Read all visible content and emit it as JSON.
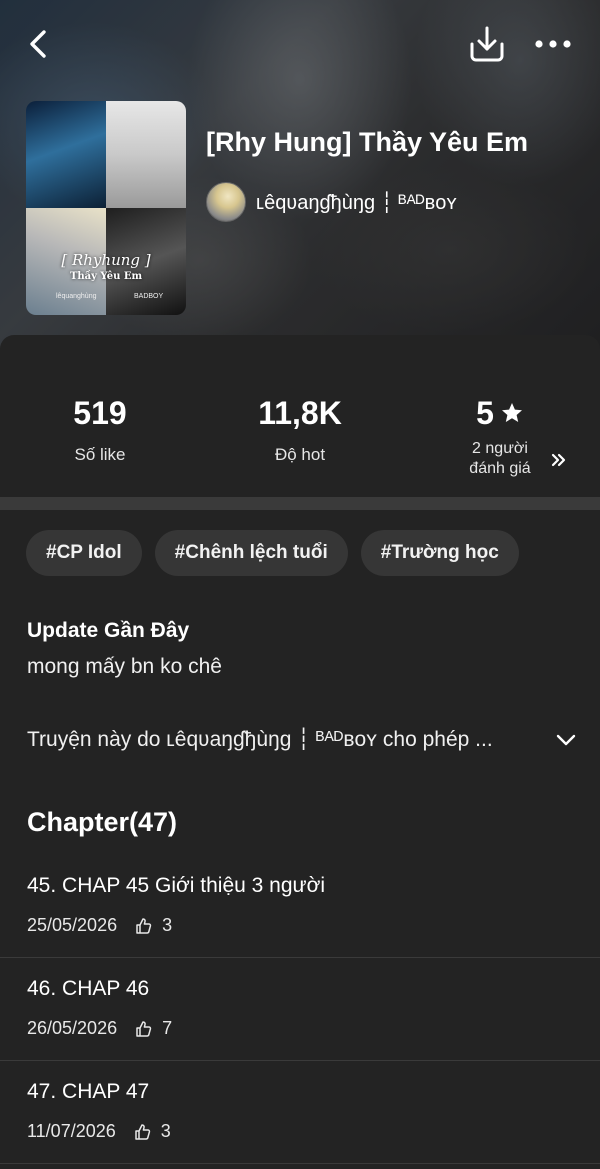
{
  "header": {
    "book_title": "[Rhy Hung] Thầy Yêu Em",
    "author_name": "ʟêqʋaŋɠђùŋg ┆ ᴮᴬᴰʙᴏʏ",
    "cover": {
      "script_text": "[ Rhyhung ]",
      "sub_text": "Thầy Yêu Em",
      "tiny_left": "lêquanghùng",
      "tiny_right": "BADBOY"
    }
  },
  "stats": {
    "likes": {
      "value": "519",
      "label": "Số like"
    },
    "hot": {
      "value": "11,8K",
      "label": "Độ hot"
    },
    "rating": {
      "value": "5",
      "label_line1": "2 người",
      "label_line2": "đánh giá"
    }
  },
  "tags": [
    "#CP Idol",
    "#Chênh lệch tuổi",
    "#Trường học"
  ],
  "update": {
    "title": "Update Gần Đây",
    "text": "mong mấy bn ko chê"
  },
  "description": "Truyện này do ʟêqʋaŋɠђùŋg ┆ ᴮᴬᴰʙᴏʏ cho phép ...",
  "chapters": {
    "heading": "Chapter(47)",
    "items": [
      {
        "title": "45. CHAP 45 Giới thiệu 3 người",
        "date": "25/05/2026",
        "likes": "3"
      },
      {
        "title": "46. CHAP 46",
        "date": "26/05/2026",
        "likes": "7"
      },
      {
        "title": "47. CHAP 47",
        "date": "11/07/2026",
        "likes": "3"
      }
    ]
  },
  "icons": {
    "back": "back-arrow-icon",
    "download": "download-icon",
    "more": "more-dots-icon",
    "star": "star-icon",
    "chevron_right": "double-chevron-right-icon",
    "chevron_down": "chevron-down-icon",
    "like": "thumbs-up-icon"
  },
  "colors": {
    "background": "#232323",
    "tag_background": "#363636",
    "divider": "#3a3a3a",
    "text": "#ffffff"
  }
}
